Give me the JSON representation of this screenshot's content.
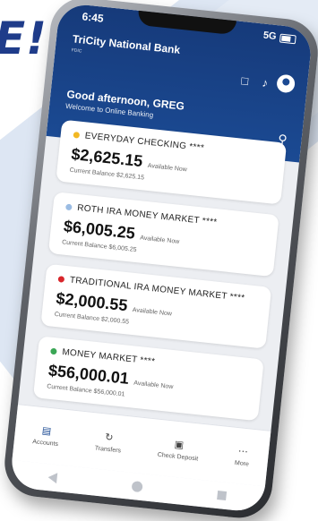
{
  "slogan": "E!",
  "status": {
    "time": "6:45",
    "signal": "5G"
  },
  "header": {
    "brand": "TriCity National Bank",
    "brand_sub": "FDIC",
    "greeting": "Good afternoon, GREG",
    "welcome": "Welcome to Online Banking"
  },
  "accounts": [
    {
      "name": "EVERYDAY CHECKING ****",
      "amount": "$2,625.15",
      "available": "Available Now",
      "current": "Current Balance $2,625.15",
      "color": "#f2b824"
    },
    {
      "name": "ROTH IRA MONEY MARKET ****",
      "amount": "$6,005.25",
      "available": "Available Now",
      "current": "Current Balance $6,005.25",
      "color": "#9bbce3"
    },
    {
      "name": "TRADITIONAL IRA MONEY MARKET ****",
      "amount": "$2,000.55",
      "available": "Available Now",
      "current": "Current Balance $2,000.55",
      "color": "#d8262b"
    },
    {
      "name": "MONEY MARKET ****",
      "amount": "$56,000.01",
      "available": "Available Now",
      "current": "Current Balance $56,000.01",
      "color": "#3aa655"
    }
  ],
  "tabs": [
    {
      "label": "Accounts",
      "icon": "wallet-icon"
    },
    {
      "label": "Transfers",
      "icon": "transfer-icon"
    },
    {
      "label": "Check Deposit",
      "icon": "camera-icon"
    },
    {
      "label": "More",
      "icon": "more-icon"
    }
  ]
}
